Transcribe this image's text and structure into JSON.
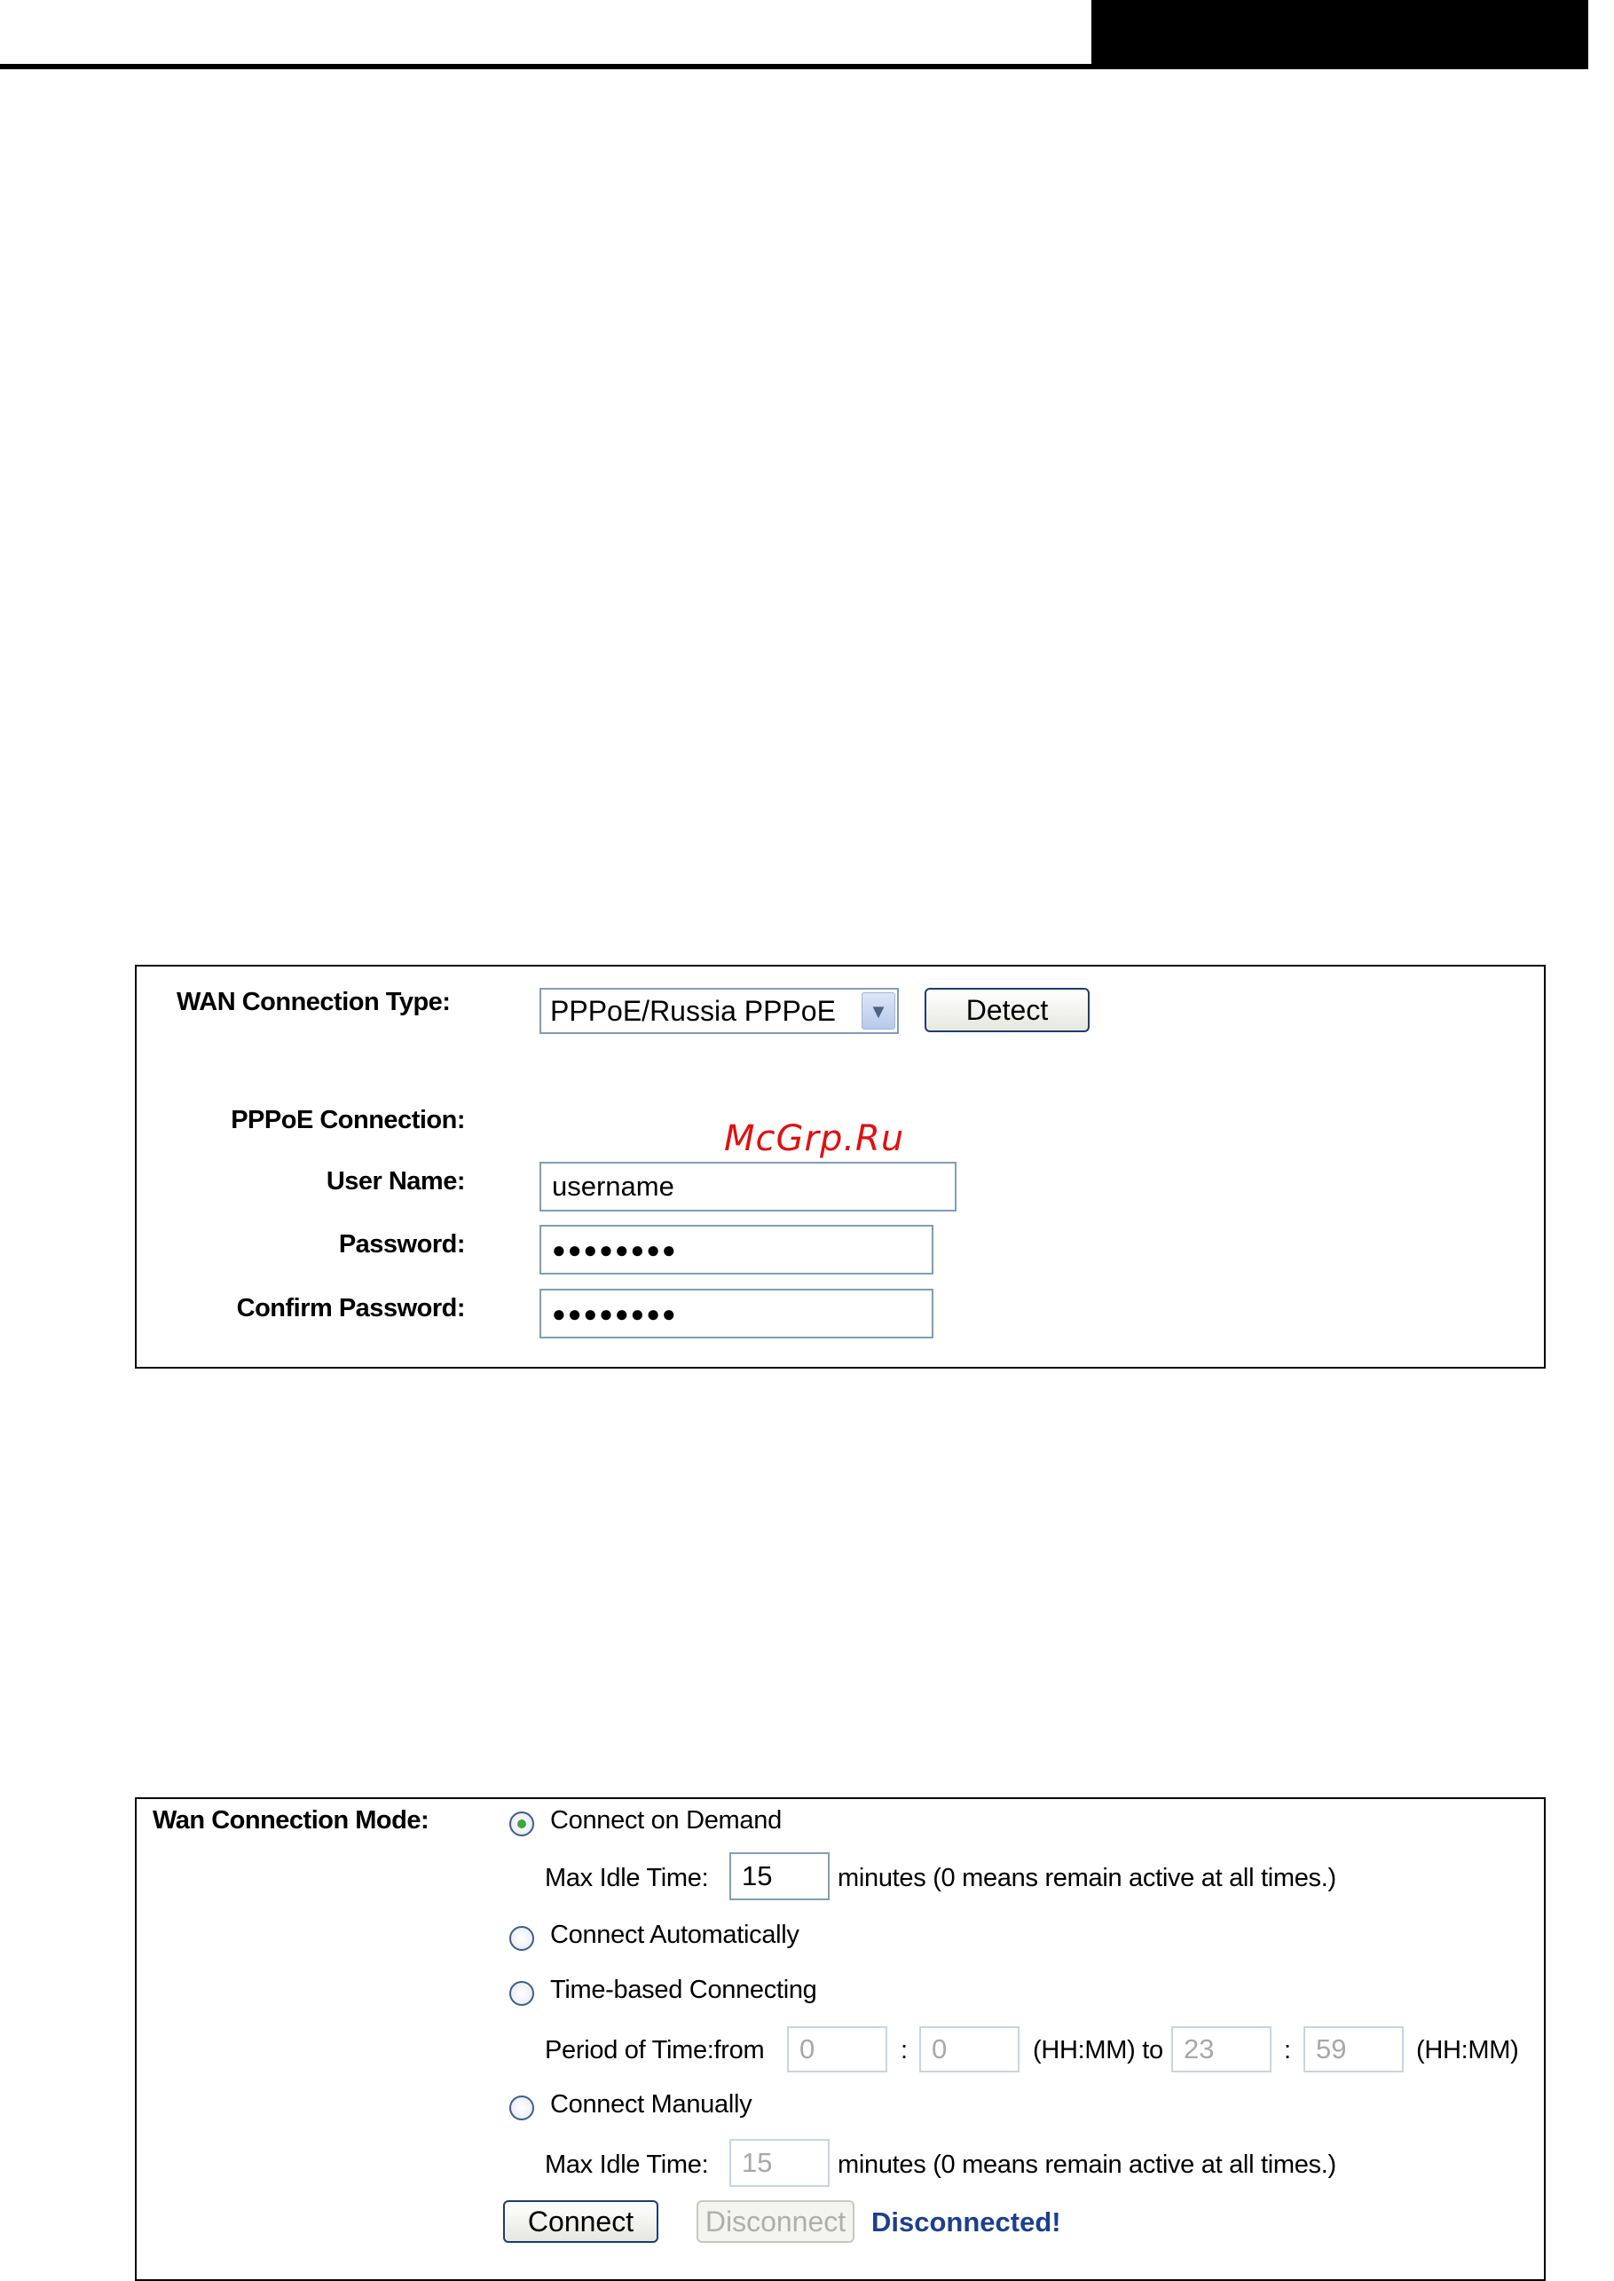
{
  "wan_type_panel": {
    "wan_connection_type_label": "WAN Connection Type:",
    "wan_connection_type_value": "PPPoE/Russia PPPoE",
    "detect_label": "Detect",
    "pppoe_connection_label": "PPPoE Connection:",
    "user_name_label": "User Name:",
    "user_name_value": "username",
    "password_label": "Password:",
    "password_value": "●●●●●●●●",
    "confirm_password_label": "Confirm Password:",
    "confirm_password_value": "●●●●●●●●",
    "watermark": "McGrp.Ru"
  },
  "wan_mode_panel": {
    "mode_label": "Wan Connection Mode:",
    "on_demand": {
      "label": "Connect on Demand",
      "checked": true,
      "idle_label": "Max Idle Time:",
      "idle_value": "15",
      "idle_suffix": "minutes (0 means remain active at all times.)"
    },
    "automatically": {
      "label": "Connect Automatically",
      "checked": false
    },
    "time_based": {
      "label": "Time-based Connecting",
      "checked": false,
      "period_label": "Period of Time:from",
      "from_hh": "0",
      "from_mm": "0",
      "colon": ":",
      "hhmm_to": "(HH:MM) to",
      "to_hh": "23",
      "to_mm": "59",
      "hhmm_end": "(HH:MM)"
    },
    "manually": {
      "label": "Connect Manually",
      "checked": false,
      "idle_label": "Max Idle Time:",
      "idle_value": "15",
      "idle_suffix": "minutes (0 means remain active at all times.)"
    },
    "connect_label": "Connect",
    "disconnect_label": "Disconnect",
    "status_text": "Disconnected!"
  },
  "colors": {
    "status": "#1b3f8f",
    "watermark": "#e01010",
    "radio_checked": "#3aa83a"
  }
}
